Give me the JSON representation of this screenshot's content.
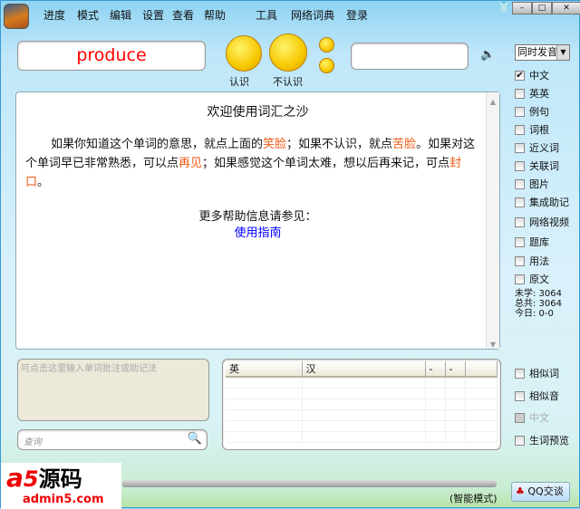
{
  "menu": [
    "进度",
    "模式",
    "编辑",
    "设置",
    "查看",
    "帮助",
    "工具",
    "网络词典",
    "登录"
  ],
  "word": "produce",
  "faces": {
    "know": "认识",
    "dontknow": "不认识"
  },
  "voice_select": "同时发音",
  "options": [
    {
      "label": "中文",
      "checked": true
    },
    {
      "label": "英英",
      "checked": false
    },
    {
      "label": "例句",
      "checked": false
    },
    {
      "label": "词根",
      "checked": false
    },
    {
      "label": "近义词",
      "checked": false
    },
    {
      "label": "关联词",
      "checked": false
    },
    {
      "label": "图片",
      "checked": false
    },
    {
      "label": "集成助记",
      "checked": false
    },
    {
      "label": "网络视频",
      "checked": false
    },
    {
      "label": "题库",
      "checked": false
    },
    {
      "label": "用法",
      "checked": false
    },
    {
      "label": "原文",
      "checked": false
    }
  ],
  "stats": {
    "unlearned": "未学: 3064",
    "total": "总共: 3064",
    "today": "今日: 0-0"
  },
  "content": {
    "title": "欢迎使用词汇之沙",
    "p1a": "如果你知道这个单词的意思，就点上面的",
    "smile": "笑脸",
    "p1b": "；如果不认识，就点",
    "bitter": "苦脸",
    "p1c": "。如果对这个单词早已非常熟悉，可以点",
    "bye": "再见",
    "p1d": "；如果感觉这个单词太难，想以后再来记，可点",
    "seal": "封口",
    "p1e": "。",
    "more": "更多帮助信息请参见：",
    "guide": "使用指南"
  },
  "notes_placeholder": "可点击这里输入单词批注或助记法",
  "search_placeholder": "查询",
  "table": {
    "headers": [
      "英",
      "汉",
      "-",
      "-",
      ""
    ]
  },
  "options2": [
    {
      "label": "相似词",
      "checked": false,
      "disabled": false
    },
    {
      "label": "相似音",
      "checked": false,
      "disabled": false
    },
    {
      "label": "中文",
      "checked": false,
      "disabled": true
    },
    {
      "label": "生词预览",
      "checked": false,
      "disabled": false
    }
  ],
  "status": "(智能模式)",
  "qq_button": "QQ交谈",
  "watermark": {
    "brand": "a5源码",
    "url": "admin5.com"
  },
  "progress": 0
}
